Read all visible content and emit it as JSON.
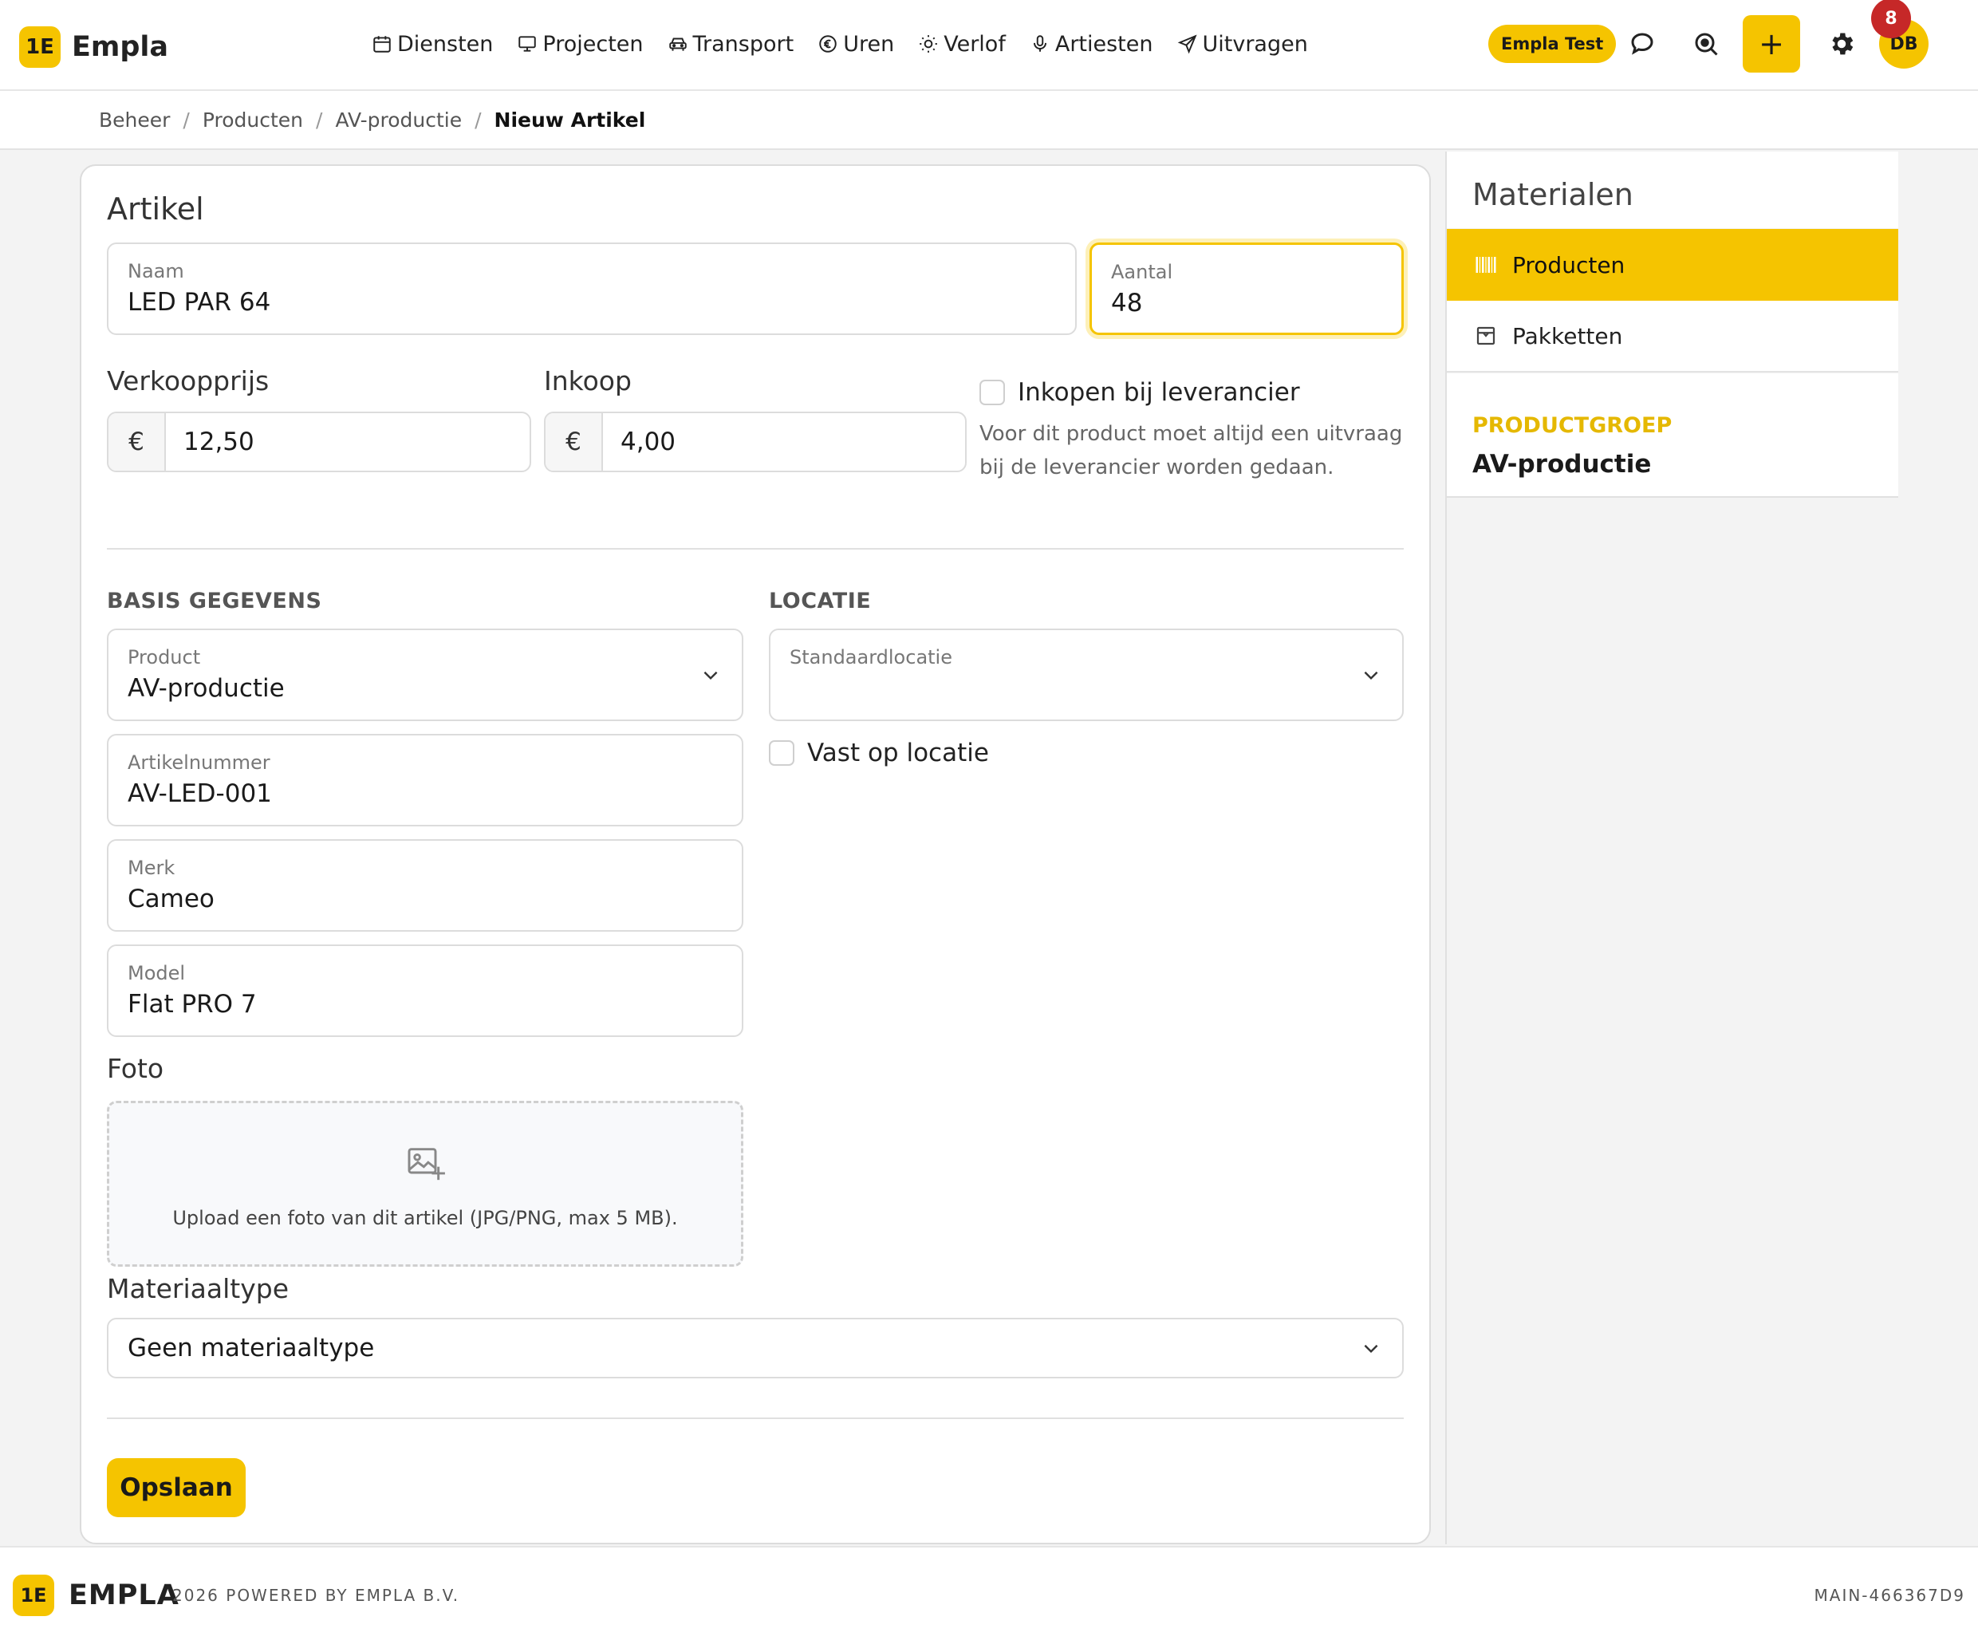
{
  "app": {
    "logo_mark": "1E",
    "name": "Empla"
  },
  "nav": [
    {
      "label": "Diensten",
      "icon": "calendar-icon"
    },
    {
      "label": "Projecten",
      "icon": "monitor-icon"
    },
    {
      "label": "Transport",
      "icon": "car-icon"
    },
    {
      "label": "Uren",
      "icon": "euro-icon"
    },
    {
      "label": "Verlof",
      "icon": "sun-icon"
    },
    {
      "label": "Artiesten",
      "icon": "microphone-icon"
    },
    {
      "label": "Uitvragen",
      "icon": "send-icon"
    }
  ],
  "header": {
    "env_badge": "Empla Test",
    "add_label": "+",
    "avatar_initials": "DB",
    "notification_count": "8",
    "accent_color": "#f5c400"
  },
  "breadcrumb": [
    {
      "label": "Beheer"
    },
    {
      "label": "Producten"
    },
    {
      "label": "AV-productie"
    },
    {
      "label": "Nieuw Artikel"
    }
  ],
  "breadcrumb_sep": "/",
  "form": {
    "section_title": "Artikel",
    "naam": {
      "label": "Naam",
      "value": "LED PAR 64"
    },
    "aantal": {
      "label": "Aantal",
      "value": "48"
    },
    "verkoopprijs": {
      "label": "Verkoopprijs",
      "currency": "€",
      "value": "12,50"
    },
    "inkoop": {
      "label": "Inkoop",
      "currency": "€",
      "value": "4,00"
    },
    "inkopen": {
      "label": "Inkopen bij leverancier",
      "checked": false,
      "help_line1": "Voor dit product moet altijd een uitvraag",
      "help_line2": "bij de leverancier worden gedaan."
    },
    "basis_title": "BASIS GEGEVENS",
    "locatie_title": "LOCATIE",
    "product": {
      "label": "Product",
      "value": "AV-productie"
    },
    "artikelnummer": {
      "label": "Artikelnummer",
      "value": "AV-LED-001"
    },
    "merk": {
      "label": "Merk",
      "value": "Cameo"
    },
    "model": {
      "label": "Model",
      "value": "Flat PRO 7"
    },
    "standaardlocatie": {
      "label": "Standaardlocatie",
      "value": ""
    },
    "vast_op_locatie": {
      "label": "Vast op locatie",
      "checked": false
    },
    "foto": {
      "label": "Foto",
      "upload_text": "Upload een foto van dit artikel (JPG/PNG, max 5 MB)."
    },
    "materiaaltype": {
      "label": "Materiaaltype",
      "value": "Geen materiaaltype"
    },
    "save_label": "Opslaan"
  },
  "sidebar": {
    "title": "Materialen",
    "items": [
      {
        "label": "Producten",
        "icon": "barcode-icon",
        "active": true
      },
      {
        "label": "Pakketten",
        "icon": "package-icon",
        "active": false
      }
    ],
    "productgroep_label": "PRODUCTGROEP",
    "productgroep_value": "AV-productie"
  },
  "footer": {
    "logo_mark": "1E",
    "brand": "EMPLA",
    "copyright": "2026 POWERED BY EMPLA B.V.",
    "build": "MAIN-466367D9"
  }
}
